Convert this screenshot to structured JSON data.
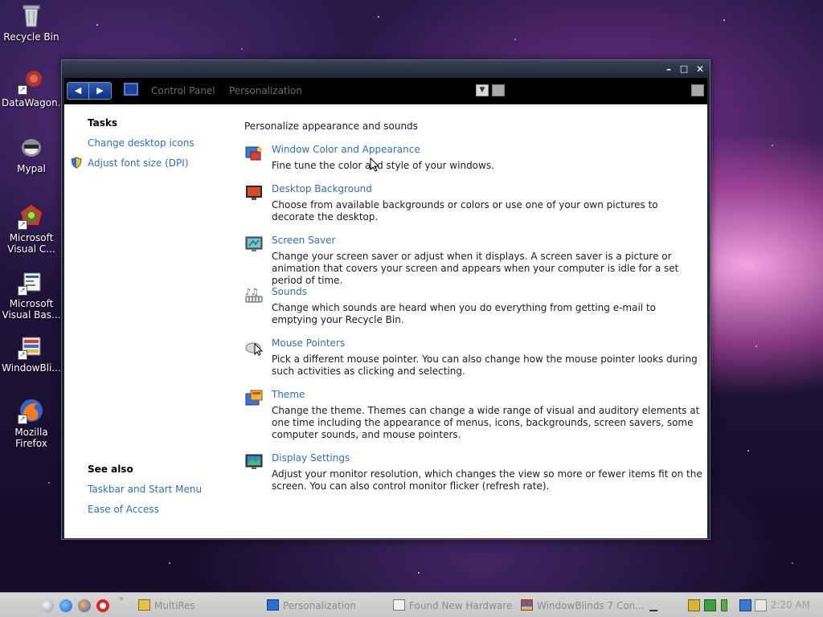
{
  "desktop": {
    "icons": [
      {
        "label": "Recycle Bin",
        "icon": "recycle-bin-icon"
      },
      {
        "label": "DataWagon...",
        "icon": "datawagon-icon"
      },
      {
        "label": "Mypal",
        "icon": "mypal-icon"
      },
      {
        "label": "Microsoft Visual C...",
        "icon": "visual-c-icon"
      },
      {
        "label": "Microsoft Visual Bas...",
        "icon": "visual-basic-icon"
      },
      {
        "label": "WindowBli...",
        "icon": "windowblinds-icon"
      },
      {
        "label": "Mozilla Firefox",
        "icon": "firefox-icon"
      }
    ]
  },
  "window": {
    "controls": {
      "minimize": "–",
      "maximize": "□",
      "close": "✕"
    },
    "nav": {
      "back": "◀",
      "forward": "▶",
      "breadcrumb": [
        "Control Panel",
        "Personalization"
      ],
      "dropdown": "▼"
    },
    "sidebar": {
      "tasks_heading": "Tasks",
      "tasks": [
        "Change desktop icons",
        "Adjust font size (DPI)"
      ],
      "see_also_heading": "See also",
      "see_also": [
        "Taskbar and Start Menu",
        "Ease of Access"
      ]
    },
    "main": {
      "heading": "Personalize appearance and sounds",
      "items": [
        {
          "title": "Window Color and Appearance",
          "desc": "Fine tune the color and style of your windows.",
          "icon": "window-color-icon"
        },
        {
          "title": "Desktop Background",
          "desc": "Choose from available backgrounds or colors or use one of your own pictures to decorate the desktop.",
          "icon": "desktop-background-icon"
        },
        {
          "title": "Screen Saver",
          "desc": "Change your screen saver or adjust when it displays. A screen saver is a picture or animation that covers your screen and appears when your computer is idle for a set period of time.",
          "icon": "screen-saver-icon"
        },
        {
          "title": "Sounds",
          "desc": "Change which sounds are heard when you do everything from getting e-mail to emptying your Recycle Bin.",
          "icon": "sounds-icon"
        },
        {
          "title": "Mouse Pointers",
          "desc": "Pick a different mouse pointer. You can also change how the mouse pointer looks during such activities as clicking and selecting.",
          "icon": "mouse-pointers-icon"
        },
        {
          "title": "Theme",
          "desc": "Change the theme. Themes can change a wide range of visual and auditory elements at one time including the appearance of menus, icons, backgrounds, screen savers, some computer sounds, and mouse pointers.",
          "icon": "theme-icon"
        },
        {
          "title": "Display Settings",
          "desc": "Adjust your monitor resolution, which changes the view so more or fewer items fit on the screen. You can also control monitor flicker (refresh rate).",
          "icon": "display-settings-icon"
        }
      ]
    }
  },
  "taskbar": {
    "quicklaunch": [
      "show-desktop-icon",
      "ie-icon",
      "firefox-icon",
      "opera-icon"
    ],
    "overflow": "»",
    "tasks": [
      {
        "label": "MultiRes",
        "icon": "multires-icon"
      },
      {
        "label": "Personalization",
        "icon": "personalization-icon"
      },
      {
        "label": "Found New Hardware",
        "icon": "hardware-icon"
      },
      {
        "label": "WindowBlinds 7 Con...",
        "icon": "windowblinds-icon"
      }
    ],
    "clock": "2:20 AM"
  },
  "colors": {
    "link": "#2f6fb7",
    "nav_button": "#1f4fa8",
    "taskbar": "#cfcfcf"
  }
}
